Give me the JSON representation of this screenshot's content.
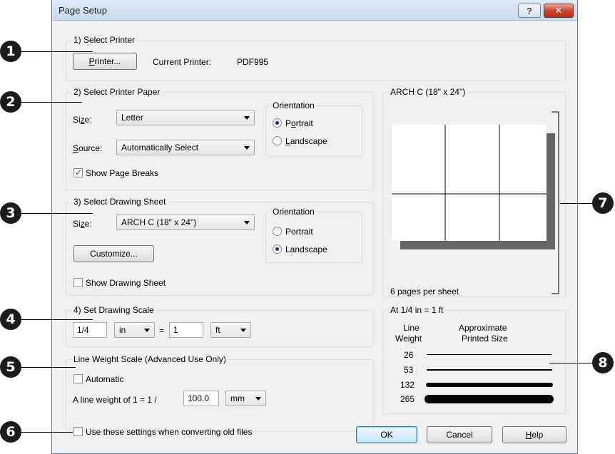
{
  "window": {
    "title": "Page Setup"
  },
  "callouts": [
    "1",
    "2",
    "3",
    "4",
    "5",
    "6",
    "7",
    "8"
  ],
  "printer": {
    "legend": "1) Select Printer",
    "button_pre": "",
    "button_u": "P",
    "button_post": "rinter...",
    "current_label": "Current Printer:",
    "current_value": "PDF995"
  },
  "paper": {
    "legend": "2) Select Printer Paper",
    "size_label_pre": "Si",
    "size_label_u": "z",
    "size_label_post": "e:",
    "size_value": "Letter",
    "source_label_pre": "",
    "source_label_u": "S",
    "source_label_post": "ource:",
    "source_value": "Automatically Select",
    "orientation_legend": "Orientation",
    "portrait_pre": "P",
    "portrait_u": "o",
    "portrait_post": "rtrait",
    "landscape_pre": "",
    "landscape_u": "L",
    "landscape_post": "andscape",
    "selected": "Portrait",
    "show_breaks": "Show Page Breaks",
    "show_breaks_checked": true
  },
  "sheet": {
    "legend": "3) Select Drawing Sheet",
    "size_label_pre": "Si",
    "size_label_u": "z",
    "size_label_post": "e:",
    "size_value": "ARCH C  (18\" x 24\")",
    "customize": "Customize...",
    "orientation_legend": "Orientation",
    "portrait": "Portrait",
    "landscape": "Landscape",
    "selected": "Landscape",
    "show_sheet": "Show Drawing Sheet",
    "show_sheet_checked": false
  },
  "scale": {
    "legend": "4) Set Drawing Scale",
    "left_value": "1/4",
    "left_unit": "in",
    "equals": "=",
    "right_value": "1",
    "right_unit": "ft"
  },
  "lineweight": {
    "legend": "Line Weight Scale (Advanced Use Only)",
    "automatic": "Automatic",
    "automatic_checked": false,
    "prefix": "A line weight of 1 = 1 /",
    "value": "100.0",
    "unit": "mm"
  },
  "convert": {
    "label": "Use these settings when converting old files",
    "checked": false
  },
  "buttons": {
    "ok": "OK",
    "cancel": "Cancel",
    "help_pre": "",
    "help_u": "H",
    "help_post": "elp"
  },
  "preview": {
    "title": "ARCH C  (18\" x 24\")",
    "pages_text": "6 pages per sheet",
    "pages_per_sheet": 6
  },
  "weights": {
    "legend": "At 1/4 in = 1 ft",
    "col1": "Line\nWeight",
    "col1a": "Line",
    "col1b": "Weight",
    "col2a": "Approximate",
    "col2b": "Printed Size",
    "rows": [
      "26",
      "53",
      "132",
      "265"
    ]
  },
  "colors": {
    "preview_shadow": "#666666",
    "accent": "#21397a"
  }
}
